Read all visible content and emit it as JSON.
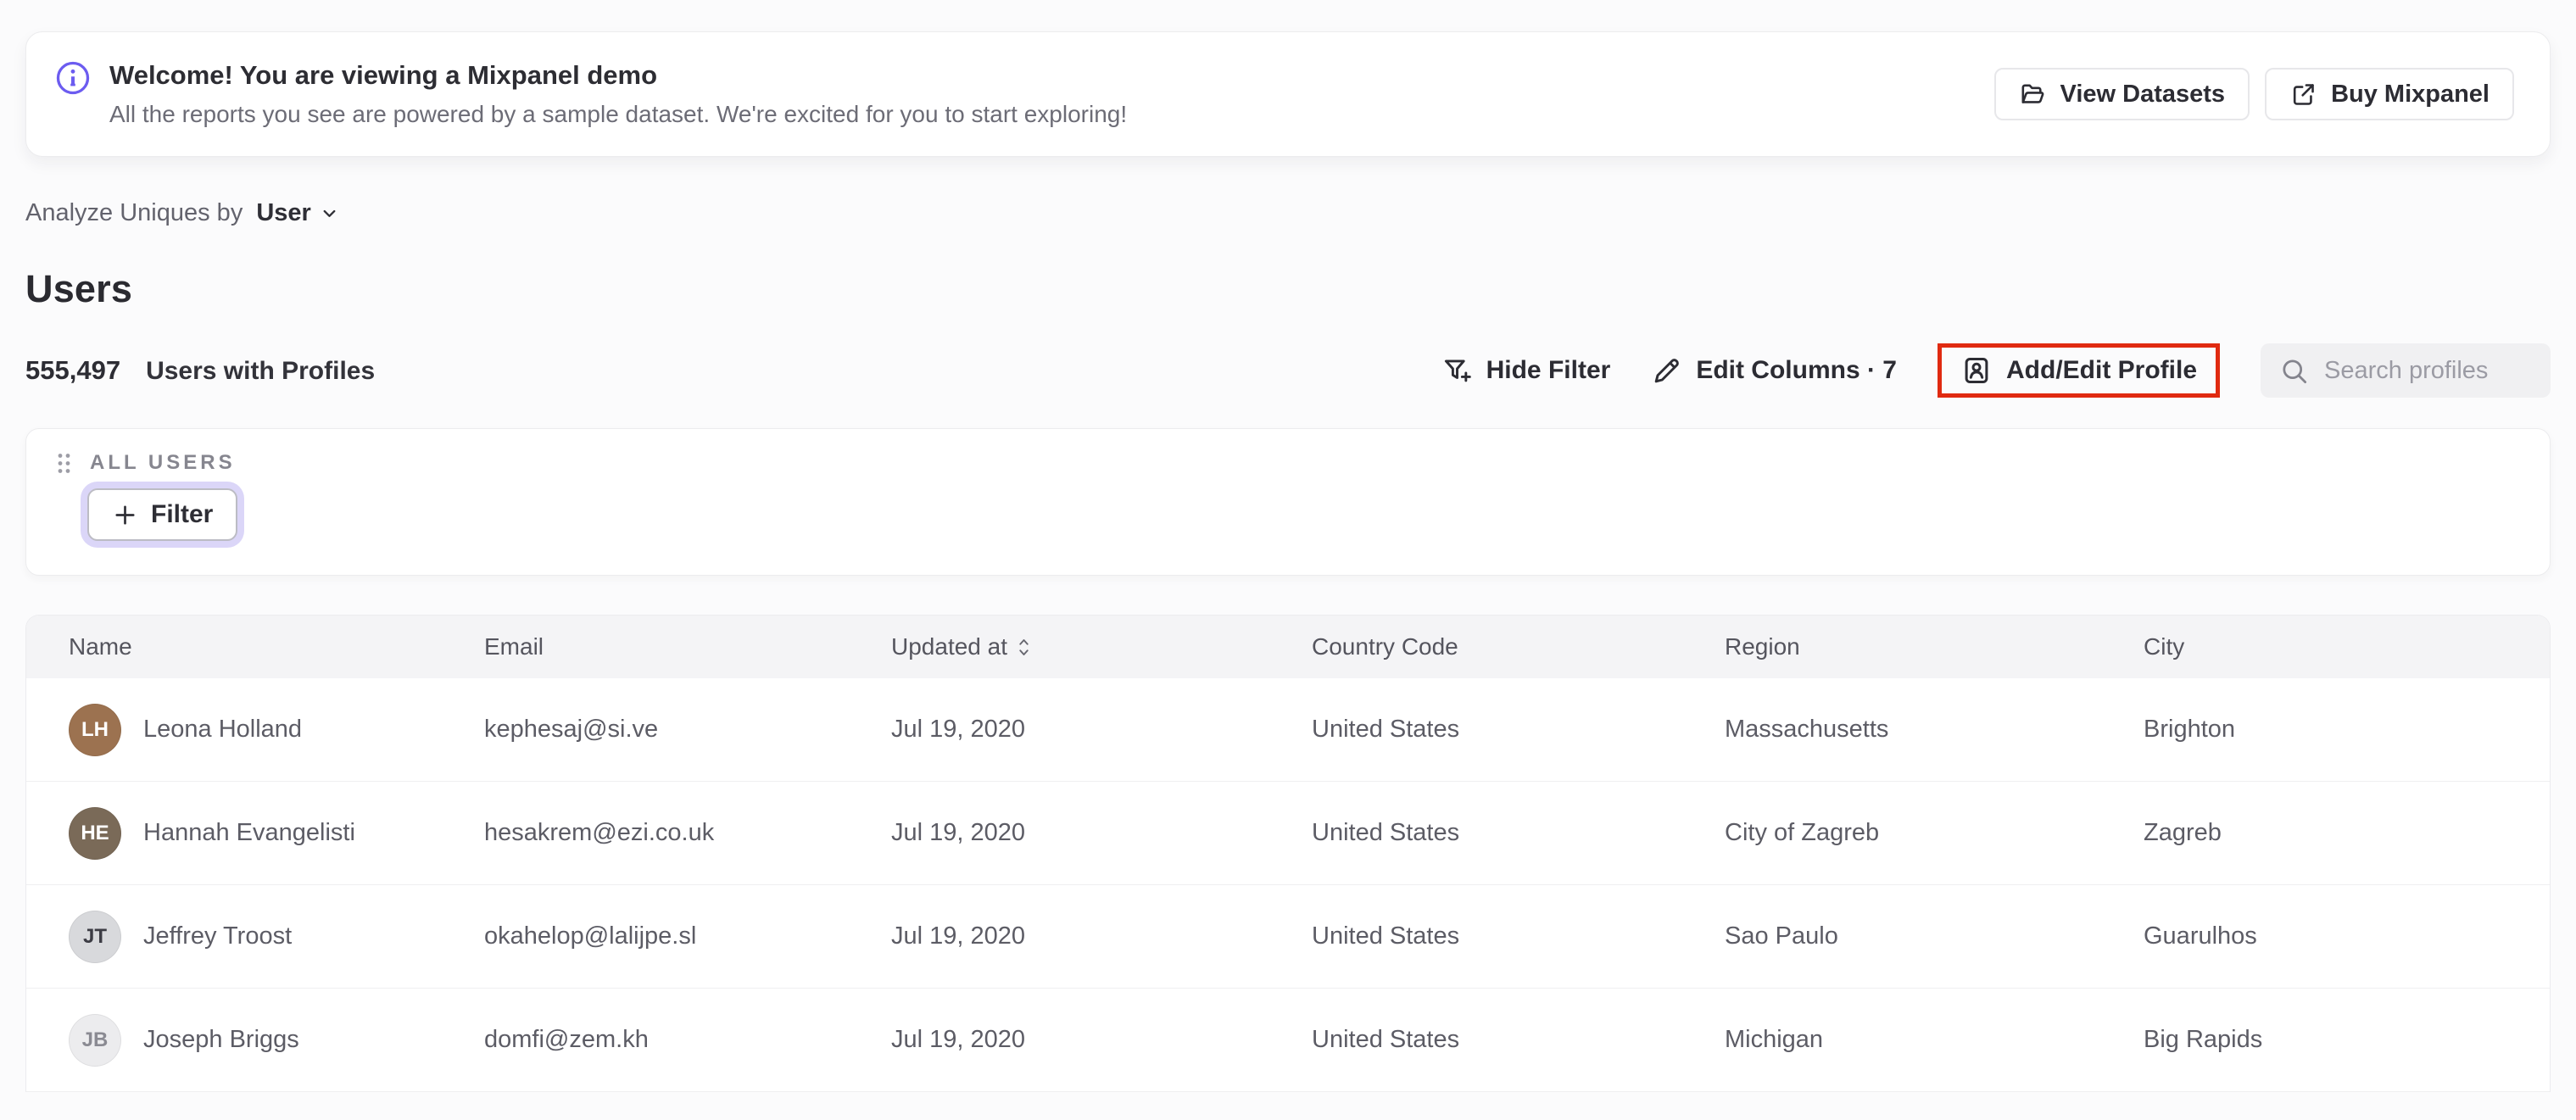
{
  "banner": {
    "title": "Welcome! You are viewing a Mixpanel demo",
    "subtitle": "All the reports you see are powered by a sample dataset. We're excited for you to start exploring!",
    "view_datasets_label": "View Datasets",
    "buy_mixpanel_label": "Buy Mixpanel"
  },
  "colors": {
    "accent_purple": "#6c5cf0",
    "annotation_red": "#e02a10",
    "filter_focus_ring": "#dbd6f8"
  },
  "analyze_bar": {
    "label": "Analyze Uniques by",
    "selected_value": "User"
  },
  "page_title": "Users",
  "summary": {
    "count": "555,497",
    "label": "Users with Profiles"
  },
  "toolbar": {
    "hide_filter_label": "Hide Filter",
    "edit_columns_label": "Edit Columns · 7",
    "add_edit_profile_label": "Add/Edit Profile",
    "search_placeholder": "Search profiles"
  },
  "filter_card": {
    "group_label": "ALL USERS",
    "filter_button_label": "Filter"
  },
  "table": {
    "columns": [
      "Name",
      "Email",
      "Updated at",
      "Country Code",
      "Region",
      "City"
    ],
    "sorted_column": "Updated at",
    "rows": [
      {
        "name": "Leona Holland",
        "initials": "LH",
        "avatar_bg": "#9c7250",
        "avatar_fg": "#ffffff",
        "email": "kephesaj@si.ve",
        "updated_at": "Jul 19, 2020",
        "country_code": "United States",
        "region": "Massachusetts",
        "city": "Brighton"
      },
      {
        "name": "Hannah Evangelisti",
        "initials": "HE",
        "avatar_bg": "#7a6a58",
        "avatar_fg": "#ffffff",
        "email": "hesakrem@ezi.co.uk",
        "updated_at": "Jul 19, 2020",
        "country_code": "United States",
        "region": "City of Zagreb",
        "city": "Zagreb"
      },
      {
        "name": "Jeffrey Troost",
        "initials": "JT",
        "avatar_bg": "#d8d9dc",
        "avatar_fg": "#3c3c44",
        "email": "okahelop@lalijpe.sl",
        "updated_at": "Jul 19, 2020",
        "country_code": "United States",
        "region": "Sao Paulo",
        "city": "Guarulhos"
      },
      {
        "name": "Joseph Briggs",
        "initials": "JB",
        "avatar_bg": "#ececee",
        "avatar_fg": "#8a8a92",
        "email": "domfi@zem.kh",
        "updated_at": "Jul 19, 2020",
        "country_code": "United States",
        "region": "Michigan",
        "city": "Big Rapids"
      }
    ]
  }
}
